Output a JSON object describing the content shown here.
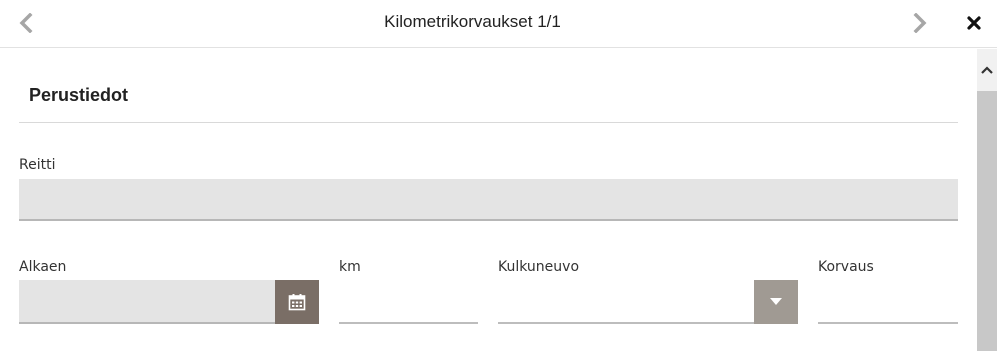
{
  "header": {
    "title": "Kilometrikorvaukset 1/1",
    "prev_icon": "chevron-left-icon",
    "next_icon": "chevron-right-icon",
    "close_icon": "close-icon"
  },
  "section": {
    "title": "Perustiedot"
  },
  "form": {
    "reitti": {
      "label": "Reitti",
      "value": ""
    },
    "alkaen": {
      "label": "Alkaen",
      "value": "",
      "icon": "calendar-icon"
    },
    "km": {
      "label": "km",
      "value": ""
    },
    "kulkuneuvo": {
      "label": "Kulkuneuvo",
      "value": "",
      "icon": "caret-down-icon"
    },
    "korvaus": {
      "label": "Korvaus",
      "value": ""
    }
  },
  "colors": {
    "field_bg": "#e4e4e4",
    "calendar_button": "#7a6e66",
    "dropdown_button": "#a09a93"
  }
}
